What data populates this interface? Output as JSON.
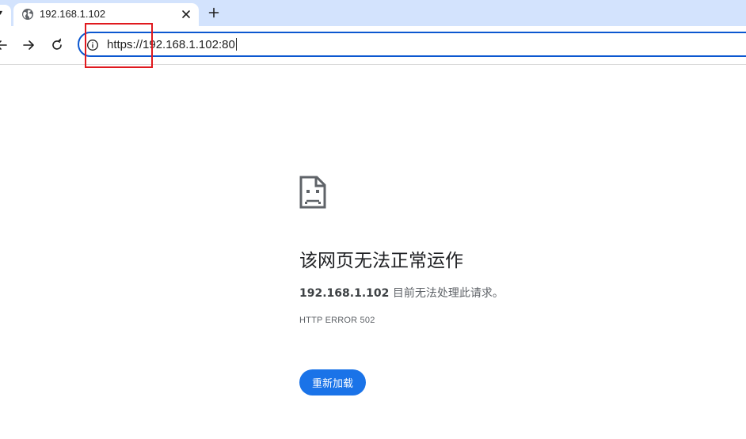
{
  "browser": {
    "tab": {
      "title": "192.168.1.102",
      "favicon": "globe-icon",
      "close_icon": "close-icon"
    },
    "new_tab_icon": "plus-icon",
    "toolbar": {
      "back_icon": "arrow-left-icon",
      "forward_icon": "arrow-right-icon",
      "reload_icon": "reload-icon",
      "site_info_icon": "info-icon"
    },
    "address_bar": {
      "value": "https://192.168.1.102:80"
    }
  },
  "error_page": {
    "icon": "sad-page-icon",
    "title": "该网页无法正常运作",
    "host": "192.168.1.102",
    "message": " 目前无法处理此请求。",
    "error_code": "HTTP ERROR 502",
    "reload_label": "重新加载"
  },
  "colors": {
    "tabstrip": "#d3e3fd",
    "omnibox_border": "#0b57d0",
    "button": "#1a73e8",
    "highlight": "#e0191e"
  }
}
